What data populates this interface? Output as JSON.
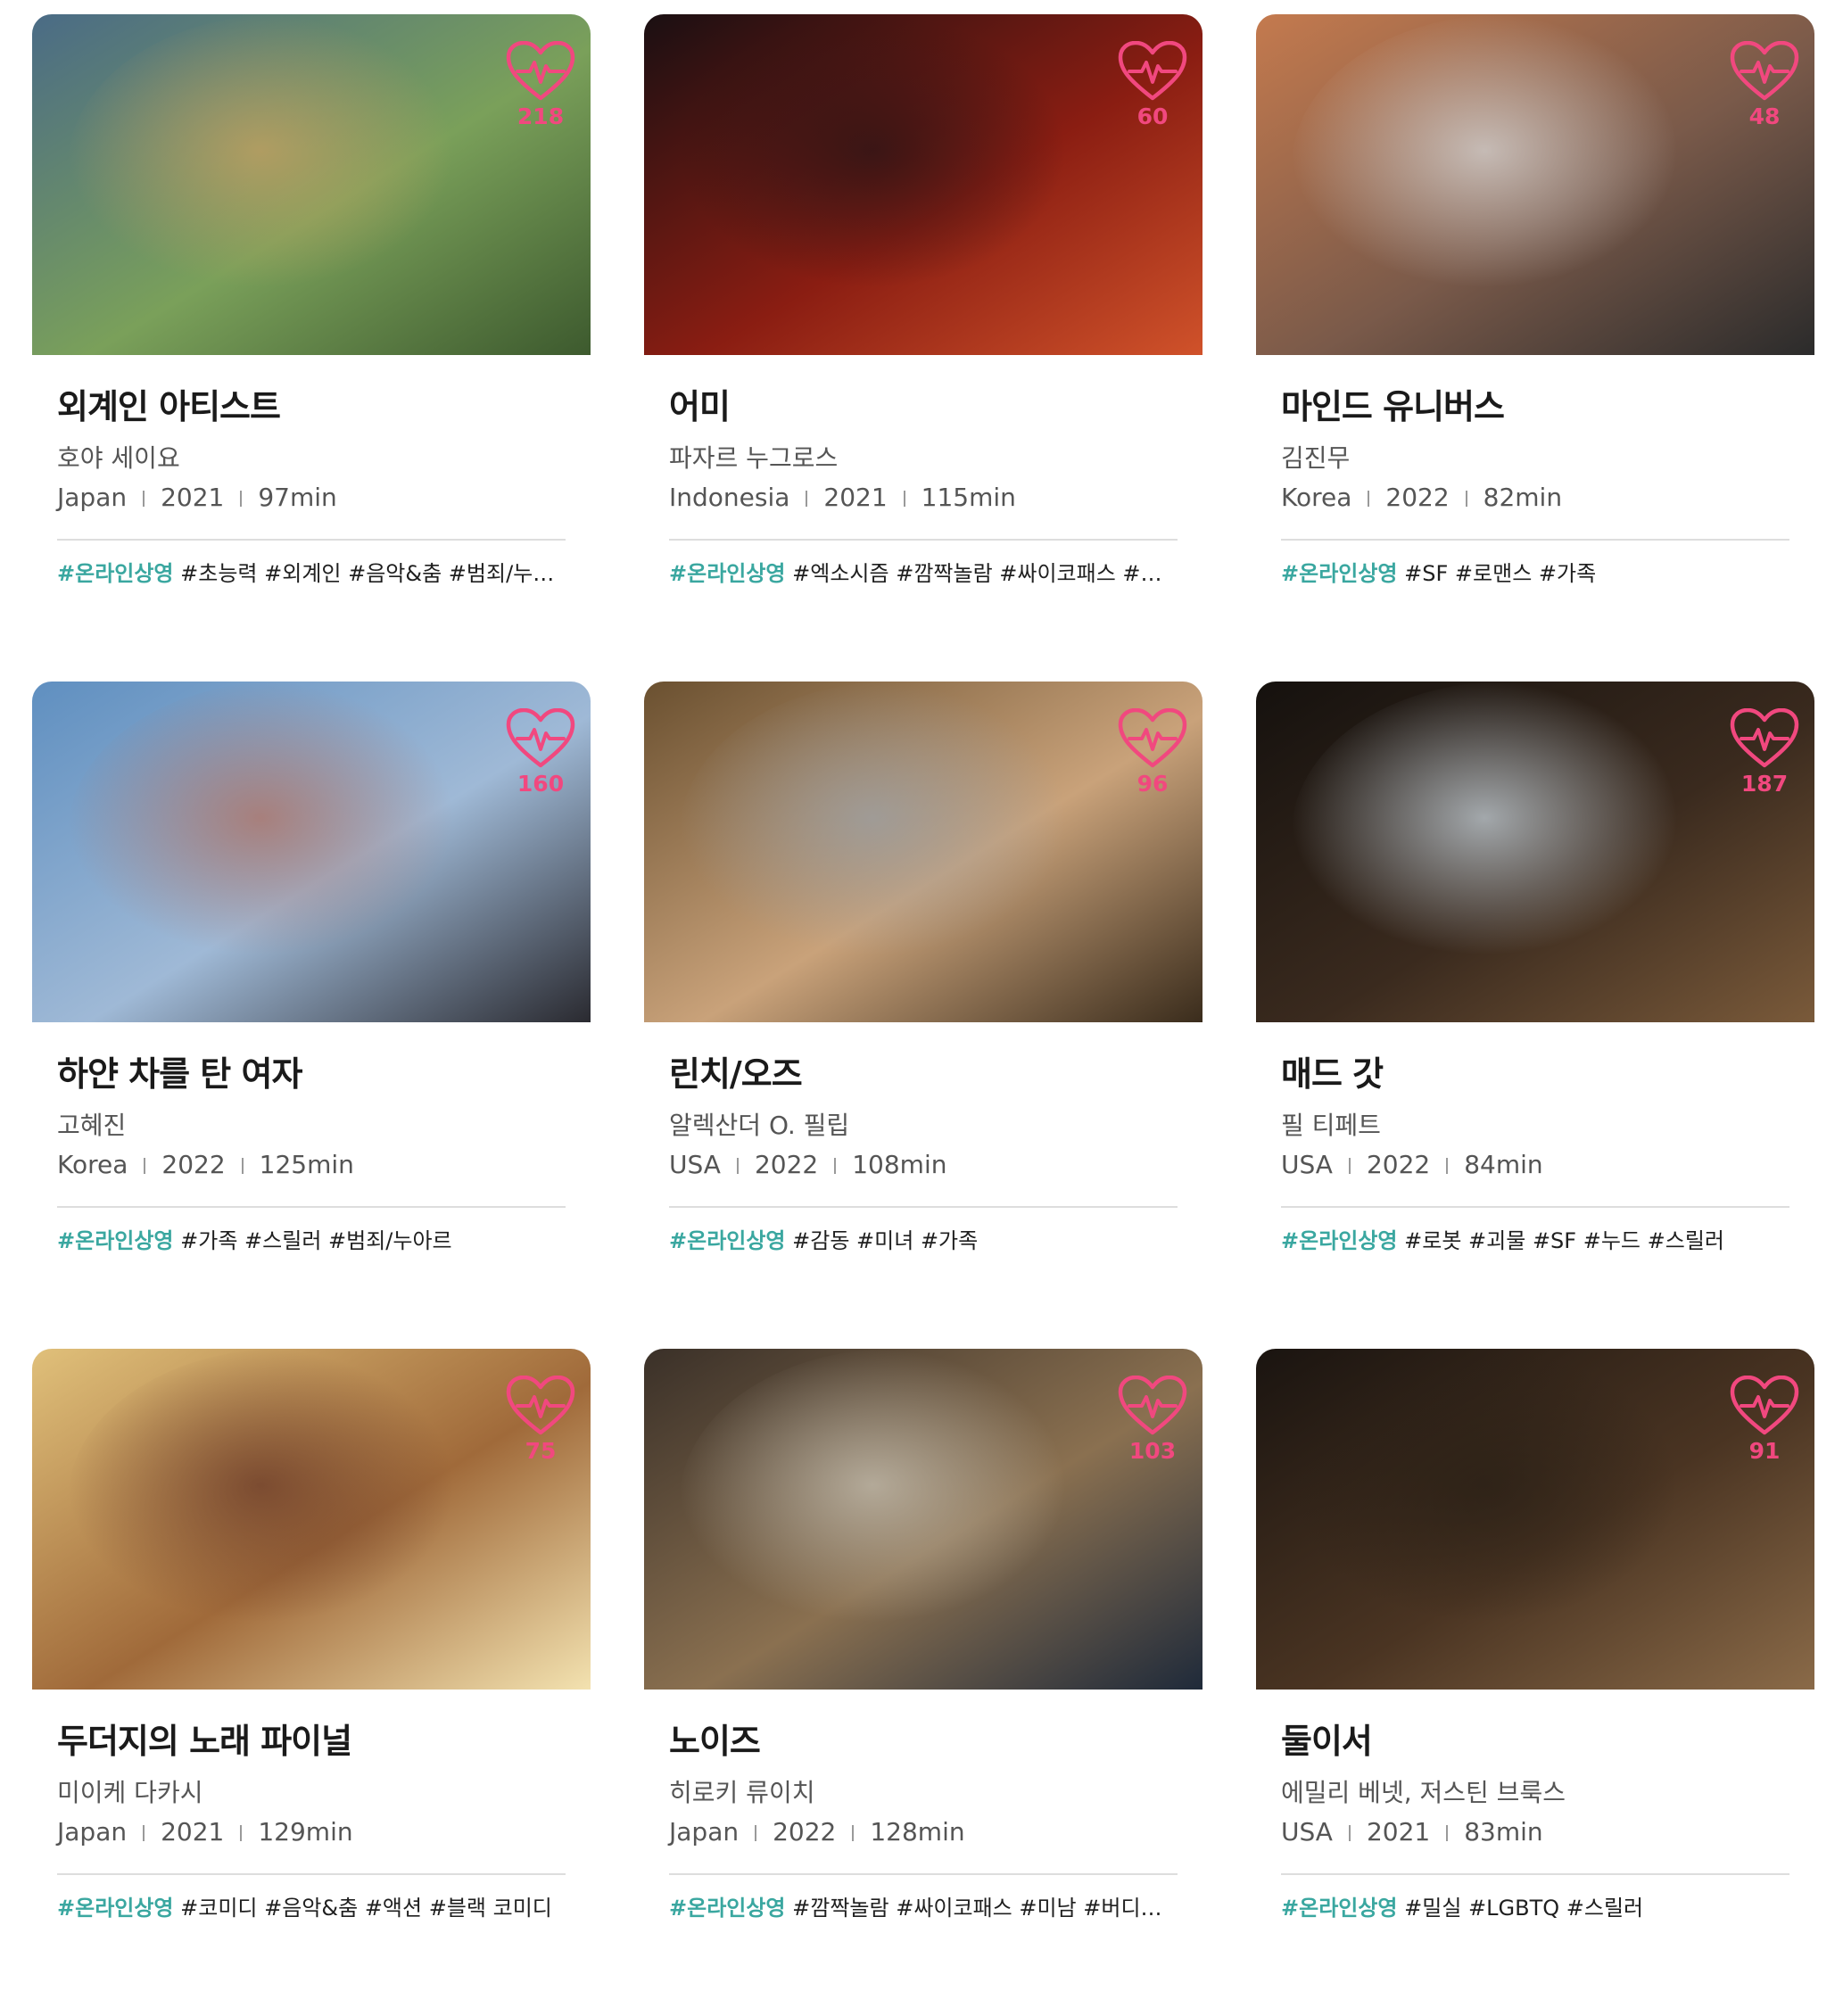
{
  "colors": {
    "like": "#f1487f",
    "online_tag": "#3aa7a0",
    "title": "#1a1a1a",
    "meta": "#555555"
  },
  "online_tag": "#온라인상영",
  "movies": [
    {
      "title": "외계인 아티스트",
      "director": "호야 세이요",
      "country": "Japan",
      "year": "2021",
      "runtime": "97min",
      "likes": "218",
      "tags": "#초능력 #외계인 #음악&춤 #범죄/누아르 #SF",
      "palette": [
        "#4a6b86",
        "#7aa05a",
        "#3d5a2e",
        "#c6a060"
      ]
    },
    {
      "title": "어미",
      "director": "파자르 누그로스",
      "country": "Indonesia",
      "year": "2021",
      "runtime": "115min",
      "likes": "60",
      "tags": "#엑소시즘 #깜짝놀람 #싸이코패스 #유령",
      "palette": [
        "#1a0f12",
        "#8a1d12",
        "#d0522a",
        "#2a1416"
      ]
    },
    {
      "title": "마인드 유니버스",
      "director": "김진무",
      "country": "Korea",
      "year": "2022",
      "runtime": "82min",
      "likes": "48",
      "tags": "#SF #로맨스 #가족",
      "palette": [
        "#c47a4e",
        "#7a5a4a",
        "#2b2b2b",
        "#d8d8d8"
      ]
    },
    {
      "title": "하얀 차를 탄 여자",
      "director": "고혜진",
      "country": "Korea",
      "year": "2022",
      "runtime": "125min",
      "likes": "160",
      "tags": "#가족 #스릴러 #범죄/누아르",
      "palette": [
        "#5f8fc0",
        "#9fb9d6",
        "#2a2a30",
        "#b07060"
      ]
    },
    {
      "title": "린치/오즈",
      "director": "알렉산더 O. 필립",
      "country": "USA",
      "year": "2022",
      "runtime": "108min",
      "likes": "96",
      "tags": "#감동 #미녀 #가족",
      "palette": [
        "#6a5030",
        "#c9a27a",
        "#3a2c1c",
        "#9aa0a6"
      ]
    },
    {
      "title": "매드 갓",
      "director": "필 티페트",
      "country": "USA",
      "year": "2022",
      "runtime": "84min",
      "likes": "187",
      "tags": "#로봇 #괴물 #SF #누드 #스릴러",
      "palette": [
        "#15110e",
        "#3a2a1e",
        "#7a5a3a",
        "#c9d4dc"
      ]
    },
    {
      "title": "두더지의 노래 파이널",
      "director": "미이케 다카시",
      "country": "Japan",
      "year": "2021",
      "runtime": "129min",
      "likes": "75",
      "tags": "#코미디 #음악&춤 #액션 #블랙 코미디",
      "palette": [
        "#e0c07a",
        "#a06a3a",
        "#f3e2b0",
        "#6a3a28"
      ]
    },
    {
      "title": "노이즈",
      "director": "히로키 류이치",
      "country": "Japan",
      "year": "2022",
      "runtime": "128min",
      "likes": "103",
      "tags": "#깜짝놀람 #싸이코패스 #미남 #버디무비 #스릴러",
      "palette": [
        "#3a3028",
        "#8a7050",
        "#1f2a3a",
        "#c8c2b4"
      ]
    },
    {
      "title": "둘이서",
      "director": "에밀리 베넷, 저스틴 브룩스",
      "country": "USA",
      "year": "2021",
      "runtime": "83min",
      "likes": "91",
      "tags": "#밀실 #LGBTQ #스릴러",
      "palette": [
        "#1a1410",
        "#4a3422",
        "#8a6a48",
        "#2a2016"
      ]
    }
  ]
}
